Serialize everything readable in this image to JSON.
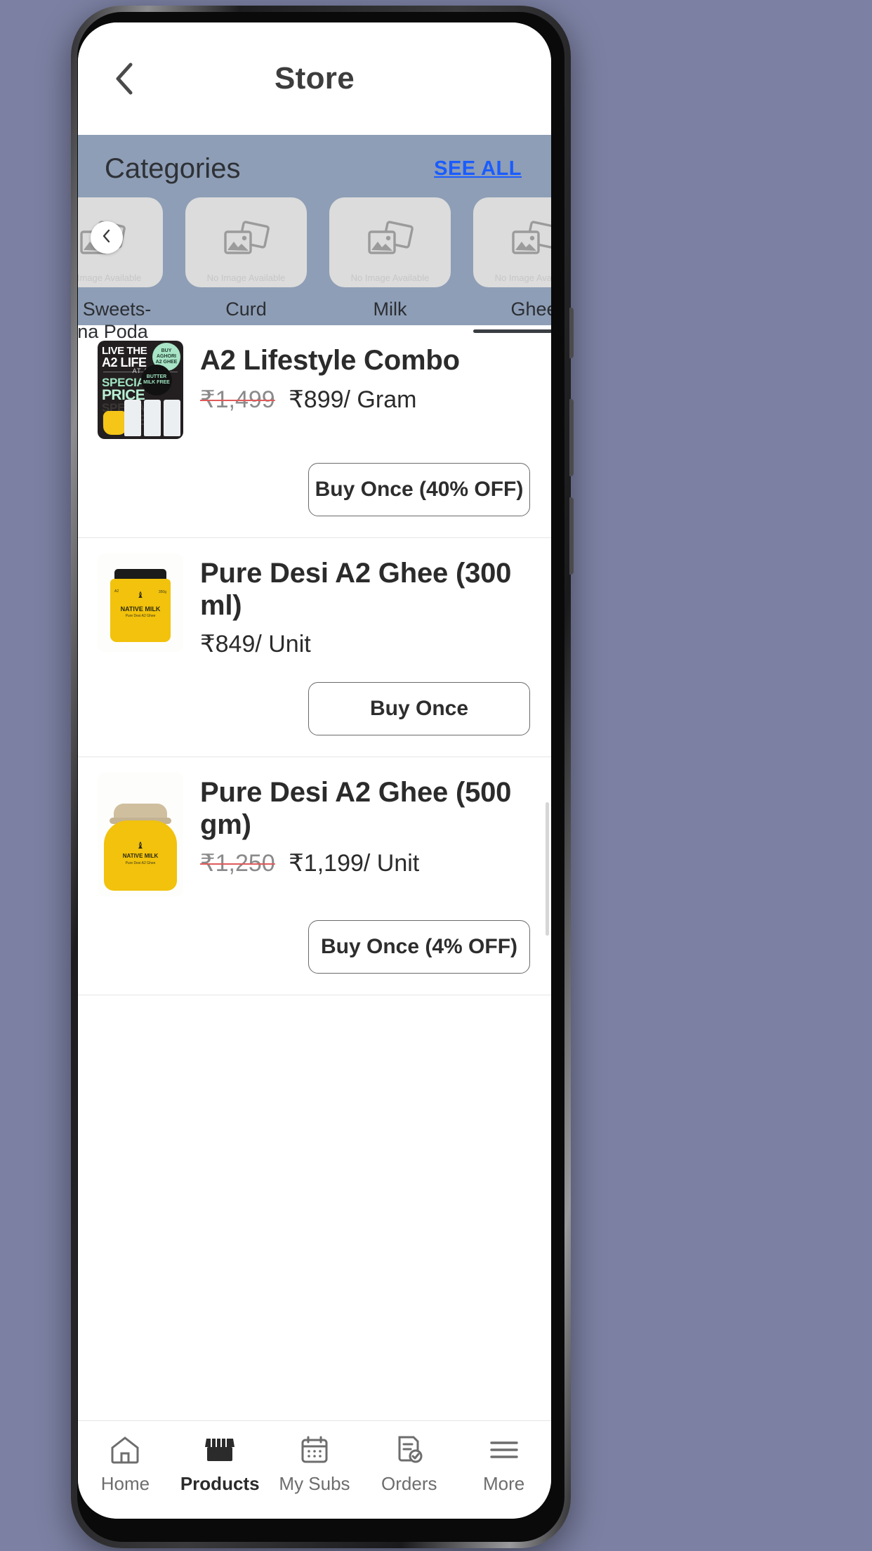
{
  "header": {
    "title": "Store",
    "back_icon": "chevron-left-icon"
  },
  "categories": {
    "title": "Categories",
    "see_all_label": "SEE ALL",
    "band_color": "#8e9eb6",
    "scroll_left_icon": "chevron-left-icon",
    "placeholder_text": "No Image Available",
    "items": [
      {
        "label": "ive Sweets-\nhena Poda",
        "line1": "ive Sweets-",
        "line2": "hena Poda",
        "active": false
      },
      {
        "label": "Curd",
        "line1": "Curd",
        "line2": "",
        "active": false
      },
      {
        "label": "Milk",
        "line1": "Milk",
        "line2": "",
        "active": false
      },
      {
        "label": "Ghee",
        "line1": "Ghee",
        "line2": "",
        "active": true
      }
    ]
  },
  "products": [
    {
      "name": "A2 Lifestyle Combo",
      "price_old": "₹1,499",
      "price_new": "₹899/ Gram",
      "buy_label": "Buy Once (40% OFF)",
      "image_type": "promo",
      "promo": {
        "line1": "LIVE THE",
        "line2": "A2 LIFE",
        "at_a": "AT A",
        "special": "SPECIAL",
        "price": "PRICE",
        "badge1": "BUY AGHORI A2 GHEE",
        "badge2": "BUTTER MILK FREE"
      }
    },
    {
      "name": "Pure Desi A2 Ghee (300 ml)",
      "price_old": "",
      "price_new": "₹849/ Unit",
      "buy_label": "Buy Once",
      "image_type": "jar300",
      "jar": {
        "brand": "NATIVE MILK",
        "sub": "Pure Desi A2 Ghee",
        "left": "A2",
        "right": "350g"
      }
    },
    {
      "name": "Pure Desi A2 Ghee (500 gm)",
      "price_old": "₹1,250",
      "price_new": "₹1,199/ Unit",
      "buy_label": "Buy Once (4% OFF)",
      "image_type": "jar500",
      "jar": {
        "brand": "NATIVE MILK",
        "sub": "Pure Desi A2 Ghee"
      }
    }
  ],
  "bottom_nav": {
    "items": [
      {
        "label": "Home",
        "icon": "home-icon",
        "active": false
      },
      {
        "label": "Products",
        "icon": "store-icon",
        "active": true
      },
      {
        "label": "My Subs",
        "icon": "calendar-icon",
        "active": false
      },
      {
        "label": "Orders",
        "icon": "order-list-icon",
        "active": false
      },
      {
        "label": "More",
        "icon": "hamburger-menu-icon",
        "active": false
      }
    ]
  },
  "colors": {
    "accent_link": "#1a5cff",
    "band": "#8e9eb6",
    "strike": "#e05a5a",
    "page_bg": "#7c81a3"
  }
}
